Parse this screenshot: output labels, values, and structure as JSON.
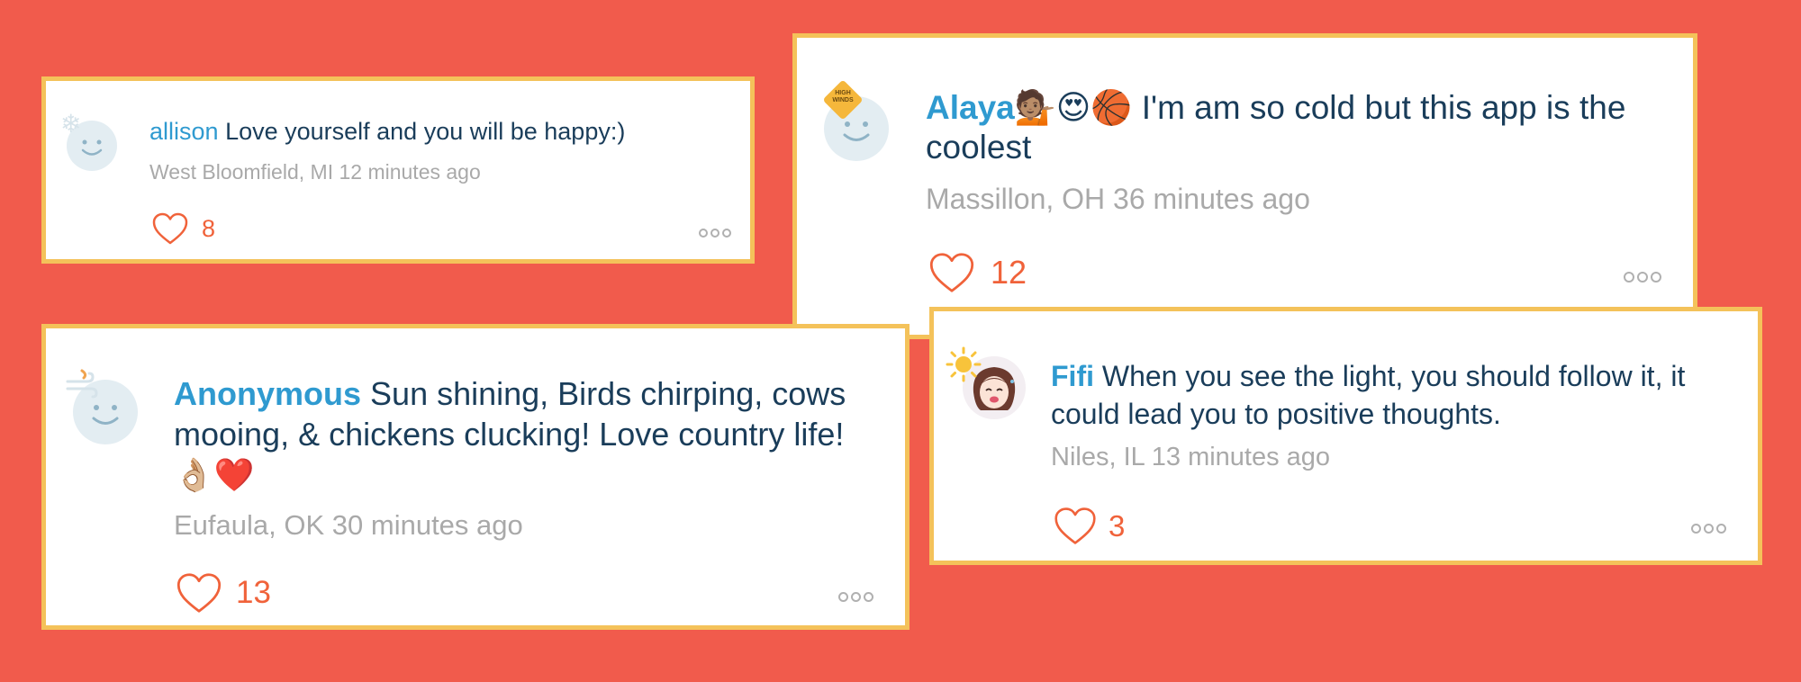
{
  "posts": [
    {
      "username": "allison",
      "message": "Love yourself and you will be happy:)",
      "location": "West Bloomfield, MI",
      "time": "12 minutes ago",
      "likes": "8",
      "badge": "snowflake-icon"
    },
    {
      "username": "Alaya",
      "emojis": "💁🏽😍🏀",
      "message": "I'm am so cold but this app is the coolest",
      "location": "Massillon, OH",
      "time": "36 minutes ago",
      "likes": "12",
      "badge_text": "HIGH WINDS"
    },
    {
      "username": "Anonymous",
      "message": "Sun shining, Birds chirping, cows mooing, & chickens clucking! Love country life!",
      "emojis": "👌🏼❤️",
      "location": "Eufaula, OK",
      "time": "30 minutes ago",
      "likes": "13",
      "badge": "wind-icon"
    },
    {
      "username": "Fifi",
      "message": "When you see the light, you should follow it, it could lead you to positive thoughts.",
      "location": "Niles, IL",
      "time": "13 minutes ago",
      "likes": "3",
      "badge": "sun-icon"
    }
  ],
  "colors": {
    "background": "#F15B4C",
    "card_border": "#F4C25A",
    "username": "#2F9AD0",
    "message": "#1A3D5A",
    "meta": "#A9A9A9",
    "like": "#F0623A"
  }
}
